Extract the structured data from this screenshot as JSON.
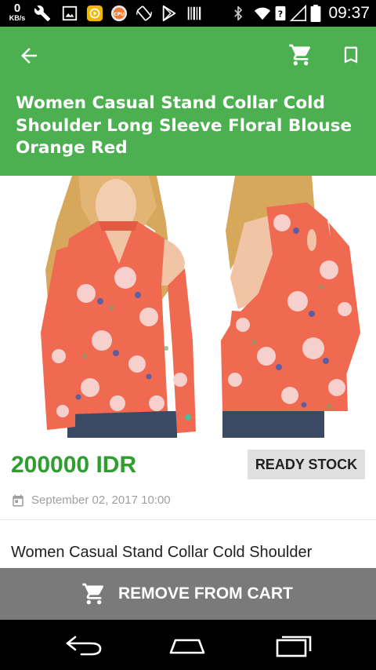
{
  "status_bar": {
    "network_speed_value": "0",
    "network_speed_unit": "KB/s",
    "time": "09:37",
    "icons": [
      "wrench-icon",
      "image-icon",
      "app-icon",
      "cpu-icon",
      "rotate-icon",
      "play-store-icon",
      "barcode-icon",
      "bluetooth-icon",
      "wifi-icon",
      "sim-unknown-icon",
      "signal-icon",
      "battery-icon"
    ]
  },
  "app_bar": {
    "background_color": "#4caf50",
    "back_icon": "arrow-back-icon",
    "cart_icon": "shopping-cart-icon",
    "bookmark_icon": "bookmark-icon",
    "title": "Women Casual Stand Collar Cold Shoulder Long Sleeve Floral Blouse Orange Red"
  },
  "product": {
    "image_description_icon": "product-photo",
    "price": "200000 IDR",
    "price_color": "#2e9e2e",
    "stock_badge": "READY STOCK",
    "date_icon": "calendar-icon",
    "date": "September 02, 2017 10:00",
    "description": "Women Casual Stand Collar Cold Shoulder"
  },
  "action": {
    "label": "REMOVE FROM CART",
    "icon": "shopping-cart-icon",
    "background_color": "#7a7a7a"
  },
  "nav_bar": {
    "icons": [
      "back-nav-icon",
      "home-nav-icon",
      "recents-nav-icon"
    ]
  }
}
